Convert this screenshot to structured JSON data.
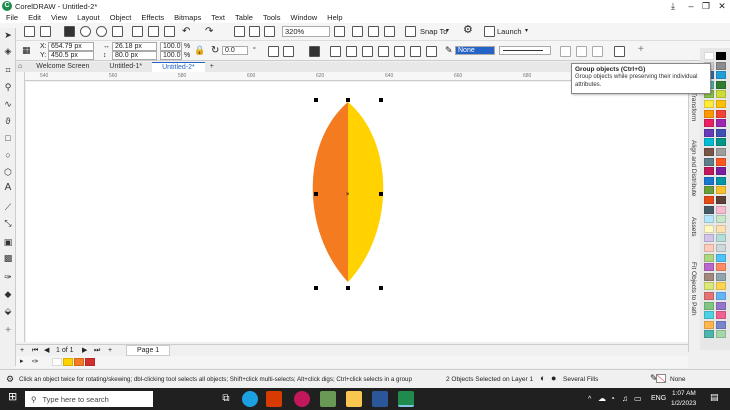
{
  "window": {
    "title": "CorelDRAW - Untitled-2*",
    "logo": "coreldraw-logo-icon",
    "minimize": "–",
    "restore": "❐",
    "close": "✕"
  },
  "menu": [
    "File",
    "Edit",
    "View",
    "Layout",
    "Object",
    "Effects",
    "Bitmaps",
    "Text",
    "Table",
    "Tools",
    "Window",
    "Help"
  ],
  "toolbar": {
    "zoom": "320%",
    "snap_to": "Snap To",
    "launch": "Launch"
  },
  "property_bar": {
    "x": "654.79 px",
    "y": "450.5 px",
    "width": "26.18 px",
    "height": "80.0 px",
    "scale_w": "100.0",
    "scale_h": "100.0",
    "percent": "%",
    "rotation": "0.0",
    "rotation_unit": "°",
    "outline_width": "None"
  },
  "tabs": [
    "Welcome Screen",
    "Untitled-1*",
    "Untitled-2*"
  ],
  "ruler_ticks_h": [
    "540",
    "560",
    "580",
    "600",
    "620",
    "640",
    "660",
    "680",
    "700",
    "720",
    "740"
  ],
  "dockers": [
    "Transform",
    "Align and Distribute",
    "Assets",
    "Fit Objects to Path"
  ],
  "tooltip": {
    "title": "Group objects (Ctrl+G)",
    "desc": "Group objects while preserving their individual attributes."
  },
  "pagebar": {
    "counter": "1 of 1",
    "page_tab": "Page 1"
  },
  "status": {
    "hint": "Click an object twice for rotating/skewing; dbl-clicking tool selects all objects; Shift+click multi-selects; Alt+click digs; Ctrl+click selects in a group",
    "selection": "2 Objects Selected on Layer 1",
    "fill": "Several Fills",
    "outline": "None"
  },
  "taskbar": {
    "search_placeholder": "Type here to search",
    "time": "1:07 AM",
    "date": "1/2/2023",
    "lang": "ENG"
  },
  "colors": {
    "left_half": "#F47B20",
    "right_half": "#FFD200",
    "accent": "#2563C7"
  },
  "palette": [
    "#ffffff",
    "#000000",
    "#d9d9d9",
    "#8c8c8c",
    "#3a6ea5",
    "#1f9fd6",
    "#4db6ac",
    "#2e7d32",
    "#8bc34a",
    "#cddc39",
    "#ffeb3b",
    "#ffc107",
    "#ff9800",
    "#f44336",
    "#e91e63",
    "#9c27b0",
    "#673ab7",
    "#3f51b5",
    "#00bcd4",
    "#009688",
    "#795548",
    "#9e9e9e",
    "#607d8b",
    "#ff5722",
    "#c2185b",
    "#7b1fa2",
    "#1976d2",
    "#0097a7",
    "#689f38",
    "#fbc02d",
    "#e64a19",
    "#5d4037",
    "#455a64",
    "#f8bbd0",
    "#b3e5fc",
    "#c8e6c9",
    "#fff9c4",
    "#ffe0b2",
    "#d1c4e9",
    "#b2dfdb",
    "#ffccbc",
    "#cfd8dc",
    "#aed581",
    "#4fc3f7",
    "#ba68c8",
    "#ff8a65",
    "#a1887f",
    "#90a4ae",
    "#dce775",
    "#ffd54f",
    "#e57373",
    "#64b5f6",
    "#81c784",
    "#9575cd",
    "#4dd0e1",
    "#f06292",
    "#ffb74d",
    "#7986cb",
    "#4db6ac",
    "#a5d6a7"
  ],
  "doc_palette": [
    "#ffffff",
    "#FFD200",
    "#F47B20",
    "#d32f2f"
  ]
}
